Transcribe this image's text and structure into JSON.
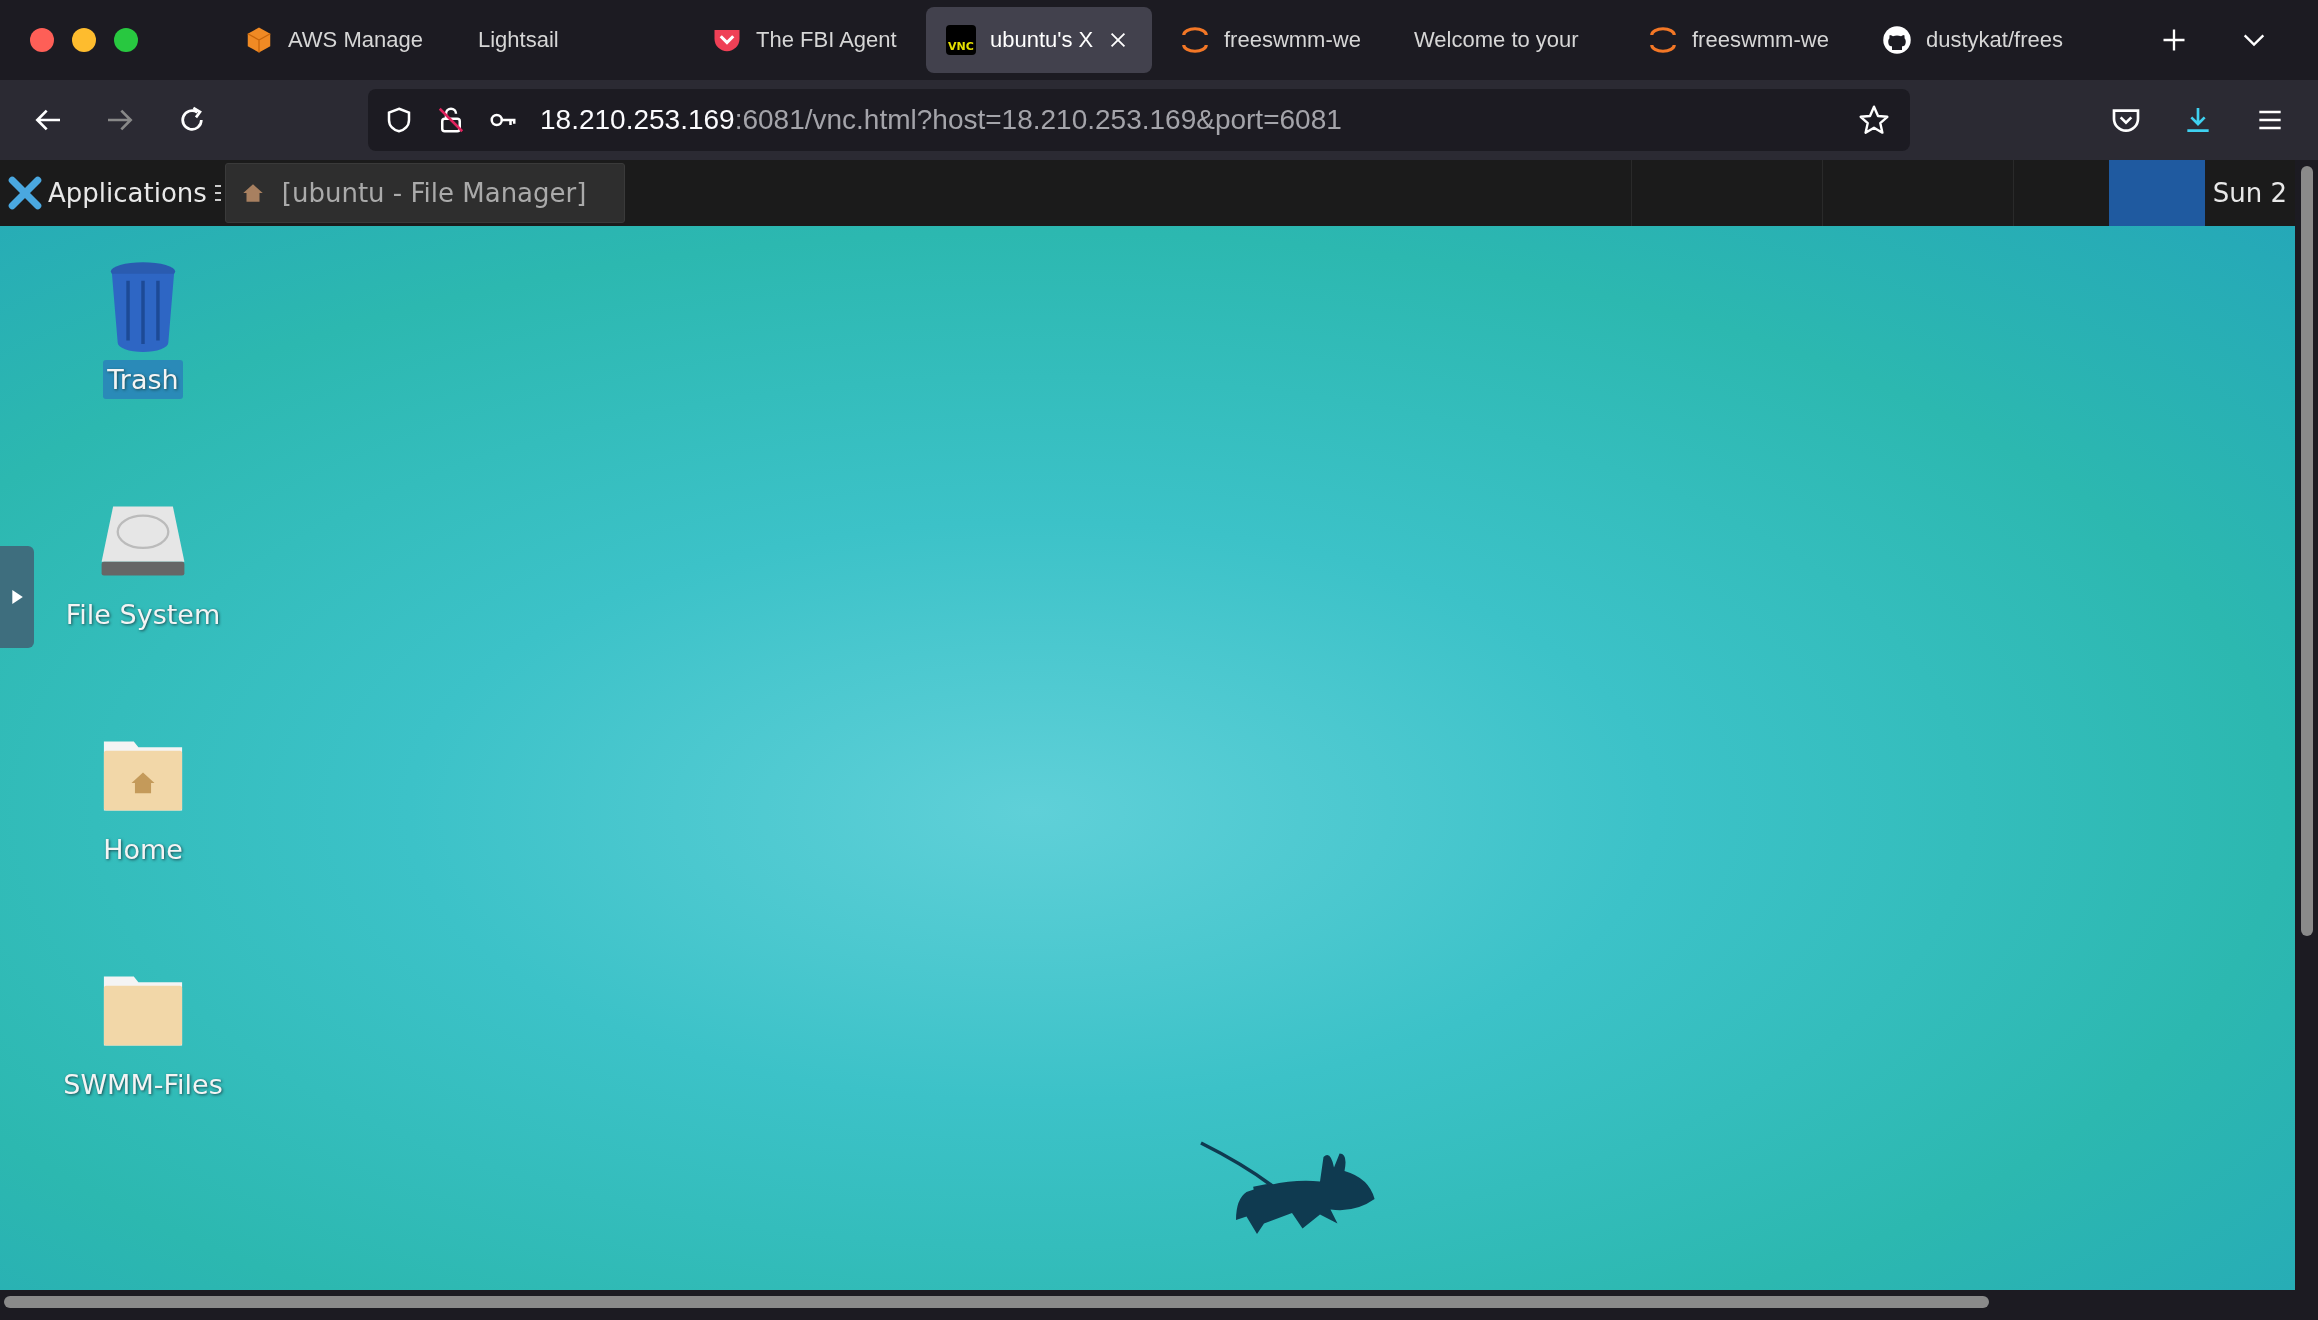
{
  "browser": {
    "tabs": [
      {
        "label": "AWS Manage",
        "kind": "cube",
        "selected": false
      },
      {
        "label": "Lightsail",
        "kind": "plain",
        "selected": false
      },
      {
        "label": "The FBI Agent",
        "kind": "pocket",
        "selected": false
      },
      {
        "label": "ubuntu's X",
        "kind": "vnc",
        "selected": true
      },
      {
        "label": "freeswmm-we",
        "kind": "jupyter",
        "selected": false
      },
      {
        "label": "Welcome to your",
        "kind": "plain",
        "selected": false
      },
      {
        "label": "freeswmm-we",
        "kind": "jupyter",
        "selected": false
      },
      {
        "label": "dustykat/frees",
        "kind": "github",
        "selected": false
      }
    ],
    "vnc_badge": "VNC",
    "url": {
      "host": "18.210.253.169",
      "rest": ":6081/vnc.html?host=18.210.253.169&port=6081"
    }
  },
  "panel": {
    "menu_label": "Applications",
    "window_button": {
      "label": "[ubuntu - File Manager]",
      "selected": false
    },
    "clock": "Sun 2"
  },
  "desktop": {
    "icons": [
      {
        "label": "Trash",
        "kind": "trash",
        "selected": true
      },
      {
        "label": "File System",
        "kind": "drive",
        "selected": false
      },
      {
        "label": "Home",
        "kind": "home",
        "selected": false
      },
      {
        "label": "SWMM-Files",
        "kind": "folder",
        "selected": false
      }
    ]
  }
}
